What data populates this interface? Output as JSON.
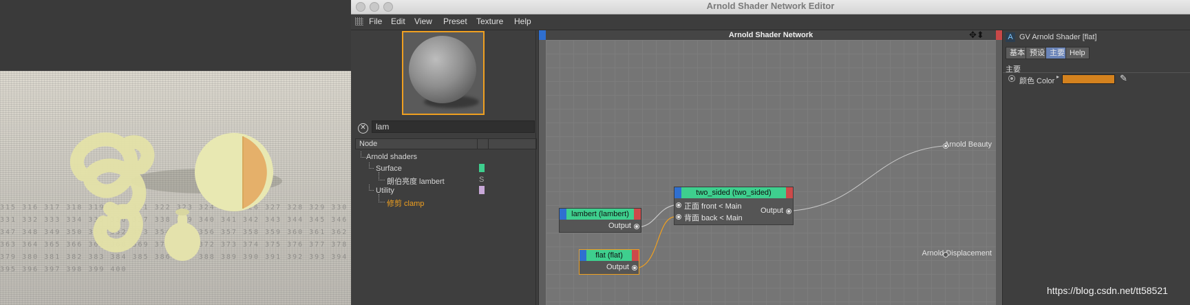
{
  "window": {
    "title": "Arnold Shader Network Editor"
  },
  "menu": [
    "File",
    "Edit",
    "View",
    "Preset",
    "Texture",
    "Help"
  ],
  "search": {
    "value": "lam",
    "clear_icon": "close-circle-icon"
  },
  "tree": {
    "header": "Node",
    "items": [
      {
        "label": "Arnold shaders",
        "color": null
      },
      {
        "label": "Surface",
        "color": "#3ecf8e"
      },
      {
        "label": "朗伯亮度 lambert",
        "tag": "S"
      },
      {
        "label": "Utility",
        "color": "#c8a8d8"
      },
      {
        "label": "修剪 clamp",
        "color": "#f0a020"
      }
    ]
  },
  "canvas": {
    "title": "Arnold Shader Network",
    "nodes": {
      "lambert": {
        "title": "lambert (lambert)",
        "output": "Output"
      },
      "flat": {
        "title": "flat (flat)",
        "output": "Output"
      },
      "two_sided": {
        "title": "two_sided (two_sided)",
        "input1": "正面 front < Main",
        "input2": "背面 back < Main",
        "output": "Output"
      }
    },
    "endpoints": {
      "beauty": "Arnold Beauty",
      "displacement": "Arnold Displacement"
    },
    "wire_colors": {
      "lambert": "#c8c8c8",
      "flat": "#f0a020",
      "beauty": "#c8c8c8"
    }
  },
  "attributes": {
    "title": "GV Arnold Shader [flat]",
    "tabs": [
      "基本",
      "预设",
      "主要",
      "Help"
    ],
    "active_tab": "主要",
    "section": "主要",
    "color_label": "颜色 Color",
    "color_value": "#d4821e",
    "picker_icon": "eyedropper-icon"
  },
  "watermark": "https://blog.csdn.net/tt58521",
  "accent_color": "#f0a020"
}
